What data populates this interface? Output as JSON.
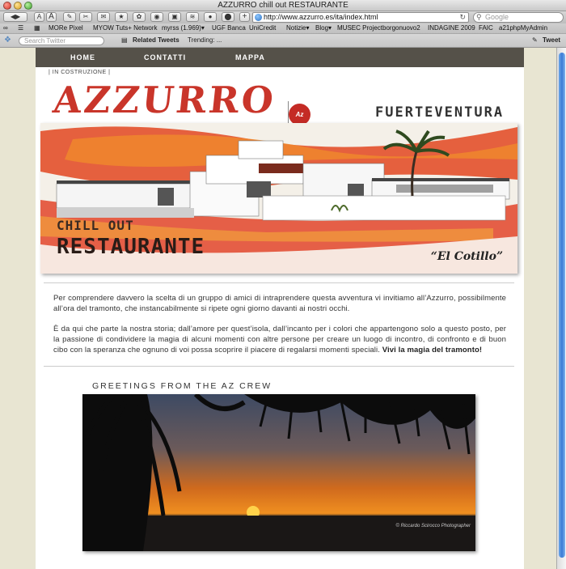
{
  "window": {
    "title": "AZZURRO chill out RESTAURANTE"
  },
  "toolbar": {
    "url": "http://www.azzurro.es/ita/index.html",
    "search_placeholder": "Google"
  },
  "bookmarks": [
    "MORe Pixel",
    "MYOW",
    "Tuts+ Network",
    "myrss (1.969)▾",
    "UGF Banca",
    "UniCredit",
    "Notizie▾",
    "Blog▾",
    "MUSEC Project",
    "borgonuovo2",
    "INDAGINE 2009",
    "FAIC",
    "a21phpMyAdmin"
  ],
  "twitter": {
    "search_placeholder": "Search Twitter",
    "related": "Related Tweets",
    "trending": "Trending: ...",
    "tweet": "Tweet"
  },
  "page": {
    "nav": [
      "HOME",
      "CONTATTI",
      "MAPPA"
    ],
    "status": "| IN COSTRUZIONE |",
    "brand": "AZZURRO",
    "logo": "Az",
    "location": "FUERTEVENTURA",
    "hero": {
      "line1": "CHILL OUT",
      "line2": "RESTAURANTE",
      "place": "“El Cotillo”"
    },
    "intro": "Per comprendere davvero la scelta di un gruppo di amici di intraprendere questa avventura vi invitiamo all’Azzurro, possibilmente all’ora del tramonto, che instancabilmente si ripete ogni giorno davanti ai nostri occhi.",
    "story": "È da qui che parte la nostra storia; dall’amore per quest’isola, dall’incanto per i colori che appartengono solo a questo posto, per la passione di condividere la magia di alcuni momenti con altre persone per creare un luogo di incontro, di confronto e di buon cibo con la speranza che ognuno di voi possa scoprire il piacere di regalarsi momenti speciali.",
    "story_bold": "Vivi la magia del tramonto!",
    "greetings": "GREETINGS FROM THE AZ CREW",
    "photo_credit": "© Riccardo Scirocco  Photographer"
  },
  "colors": {
    "brand_red": "#c9352a",
    "nav_bg": "#555149",
    "page_bg": "#e8e5d2"
  }
}
